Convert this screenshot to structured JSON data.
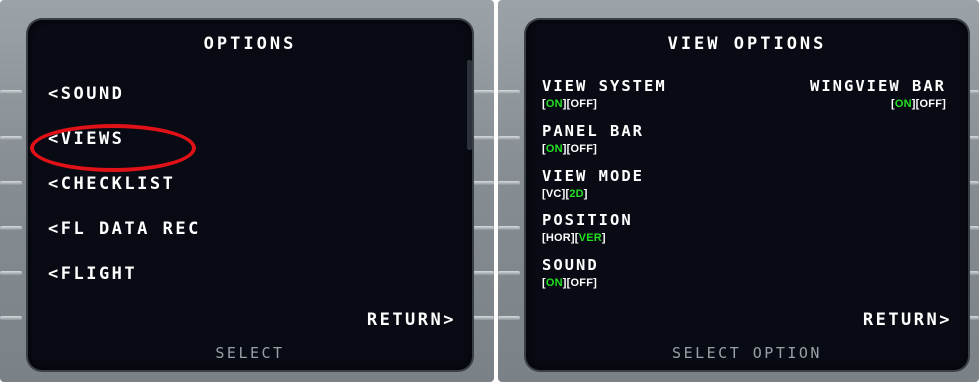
{
  "left_panel": {
    "title": "OPTIONS",
    "items": [
      {
        "label": "<SOUND"
      },
      {
        "label": "<VIEWS"
      },
      {
        "label": "<CHECKLIST"
      },
      {
        "label": "<FL DATA REC"
      },
      {
        "label": "<FLIGHT"
      }
    ],
    "return_label": "RETURN>",
    "footer": "SELECT",
    "highlight_color": "#e01218"
  },
  "right_panel": {
    "title": "VIEW OPTIONS",
    "options": {
      "view_system": {
        "label": "VIEW SYSTEM",
        "values": [
          "ON",
          "OFF"
        ],
        "selected": "ON"
      },
      "wingview_bar": {
        "label": "WINGVIEW BAR",
        "values": [
          "ON",
          "OFF"
        ],
        "selected": "ON"
      },
      "panel_bar": {
        "label": "PANEL BAR",
        "values": [
          "ON",
          "OFF"
        ],
        "selected": "ON"
      },
      "view_mode": {
        "label": "VIEW MODE",
        "values": [
          "VC",
          "2D"
        ],
        "selected": "2D"
      },
      "position": {
        "label": "POSITION",
        "values": [
          "HOR",
          "VER"
        ],
        "selected": "VER"
      },
      "sound": {
        "label": "SOUND",
        "values": [
          "ON",
          "OFF"
        ],
        "selected": "ON"
      }
    },
    "return_label": "RETURN>",
    "footer": "SELECT OPTION",
    "selected_color": "#22e022"
  }
}
